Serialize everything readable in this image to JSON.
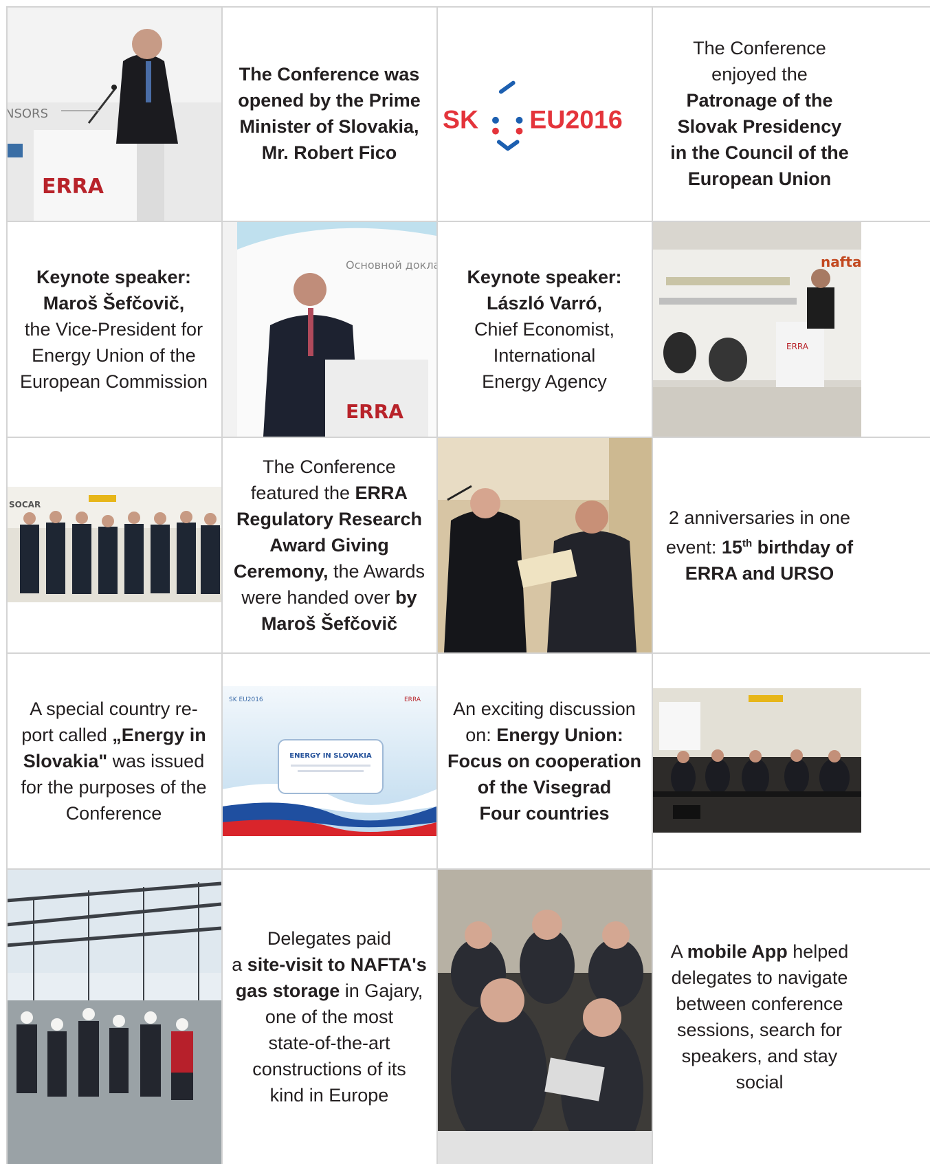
{
  "cells": {
    "r1c2": {
      "l1": "The Conference was",
      "l2": "opened by the Prime",
      "l3": "Minister of Slovakia,",
      "l4": "Mr. Robert Fico"
    },
    "r1c3": {
      "logo_sk": "SK",
      "logo_eu": "EU2016"
    },
    "r1c4": {
      "l1": "The Conference",
      "l2": "enjoyed the",
      "l3": "Patronage of the",
      "l4": "Slovak Presidency",
      "l5": "in the Council of the",
      "l6": "European Union"
    },
    "r2c1": {
      "l1": "Keynote speaker:",
      "l2": "Maroš Šefčovič,",
      "l3": "the Vice-President for",
      "l4": "Energy Union of the",
      "l5": "European Commission"
    },
    "r2c3": {
      "l1": "Keynote speaker:",
      "l2": "László Varró,",
      "l3": "Chief Economist,",
      "l4": "International",
      "l5": "Energy Agency"
    },
    "r3c2": {
      "l1": "The Conference",
      "l2a": "featured the ",
      "l2b": "ERRA",
      "l3": "Regulatory Research",
      "l4": "Award Giving",
      "l5a": "Ceremony,",
      "l5b": " the Awards",
      "l6a": "were handed over ",
      "l6b": "by",
      "l7": "Maroš Šefčovič"
    },
    "r3c4": {
      "l1": "2 anniversaries in one",
      "l2a": "event: ",
      "l2b": "15",
      "l2sup": "th",
      "l2c": " birthday of",
      "l3": "ERRA and URSO"
    },
    "r4c1": {
      "l1": "A special country re-",
      "l2a": "port called ",
      "l2b": "„Energy in",
      "l3a": "Slovakia\"",
      "l3b": " was issued",
      "l4": "for the purposes of the",
      "l5": "Conference"
    },
    "r4c2": {
      "cover_title": "ENERGY IN SLOVAKIA",
      "cover_logo_sk": "SK EU2016",
      "cover_logo_erra": "ERRA"
    },
    "r4c3": {
      "l1": "An exciting discussion",
      "l2a": "on: ",
      "l2b": "Energy Union:",
      "l3": "Focus on cooperation",
      "l4": "of the Visegrad",
      "l5": "Four countries"
    },
    "r5c2": {
      "l1": "Delegates paid",
      "l2a": "a ",
      "l2b": "site-visit to NAFTA's",
      "l3a": "gas storage",
      "l3b": " in Gajary,",
      "l4": "one of the most",
      "l5": "state-of-the-art",
      "l6": "constructions of its",
      "l7": "kind in Europe"
    },
    "r5c4": {
      "l1a": "A ",
      "l1b": "mobile App",
      "l1c": " helped",
      "l2": "delegates to navigate",
      "l3": "between conference",
      "l4": "sessions, search for",
      "l5": "speakers, and stay",
      "l6": "social"
    }
  },
  "photos": {
    "r1c1": {
      "sign_text": "NSORS",
      "logo": "ERRA"
    },
    "r2c2": {
      "screen_text": "Основной доклад:",
      "logo": "ERRA"
    },
    "r2c4": {
      "logo": "ERRA",
      "sponsor": "nafta"
    },
    "r3c1": {
      "sponsor": "SOCAR"
    }
  },
  "colors": {
    "grid": "#d4d4d4",
    "text": "#231f20",
    "sk_red": "#e4343b",
    "sk_blue": "#1c5fb0"
  }
}
